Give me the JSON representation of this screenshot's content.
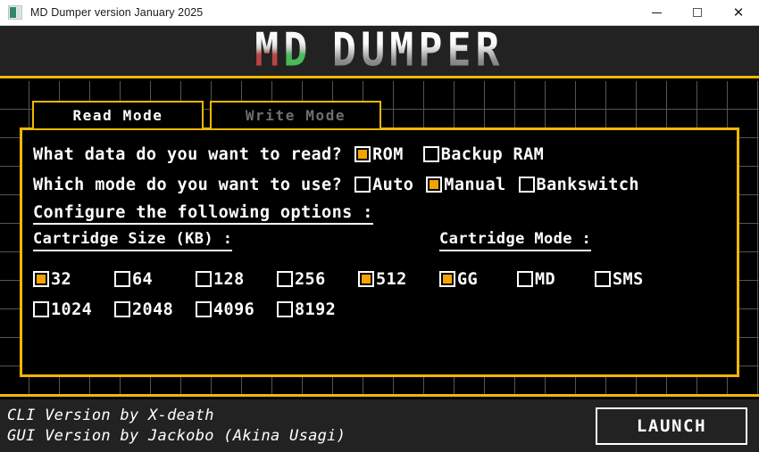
{
  "window": {
    "title": "MD Dumper version January 2025",
    "icon": "app-icon",
    "controls": {
      "minimize": "minimize-icon",
      "maximize": "maximize-icon",
      "close": "close-icon"
    }
  },
  "logo": {
    "part_m": "M",
    "part_d": "D",
    "part_rest": "DUMPER",
    "accent_red": "#c23b3b",
    "accent_green": "#3eb84f"
  },
  "theme": {
    "border_orange": "#f2b705",
    "checkbox_fill": "#f5a300",
    "panel_background": "#000000",
    "chrome_background": "#222222"
  },
  "tabs": [
    {
      "label": "Read Mode",
      "active": true
    },
    {
      "label": "Write Mode",
      "active": false
    }
  ],
  "form": {
    "question_data": "What data do you want to read?",
    "data_options": [
      {
        "label": "ROM",
        "checked": true
      },
      {
        "label": "Backup RAM",
        "checked": false
      }
    ],
    "question_mode": "Which mode do you want to use?",
    "mode_options": [
      {
        "label": "Auto",
        "checked": false
      },
      {
        "label": "Manual",
        "checked": true
      },
      {
        "label": "Bankswitch",
        "checked": false
      }
    ],
    "configure_title": "Configure the following options :"
  },
  "cartridge_size": {
    "heading": "Cartridge Size (KB) :",
    "row1": [
      {
        "label": "32",
        "checked": true
      },
      {
        "label": "64",
        "checked": false
      },
      {
        "label": "128",
        "checked": false
      },
      {
        "label": "256",
        "checked": false
      },
      {
        "label": "512",
        "checked": true
      }
    ],
    "row2": [
      {
        "label": "1024",
        "checked": false
      },
      {
        "label": "2048",
        "checked": false
      },
      {
        "label": "4096",
        "checked": false
      },
      {
        "label": "8192",
        "checked": false
      }
    ]
  },
  "cartridge_mode": {
    "heading": "Cartridge Mode :",
    "options": [
      {
        "label": "GG",
        "checked": true
      },
      {
        "label": "MD",
        "checked": false
      },
      {
        "label": "SMS",
        "checked": false
      }
    ]
  },
  "footer": {
    "credit_cli": "CLI Version by X-death",
    "credit_gui": "GUI Version by Jackobo (Akina Usagi)",
    "launch_label": "LAUNCH"
  }
}
